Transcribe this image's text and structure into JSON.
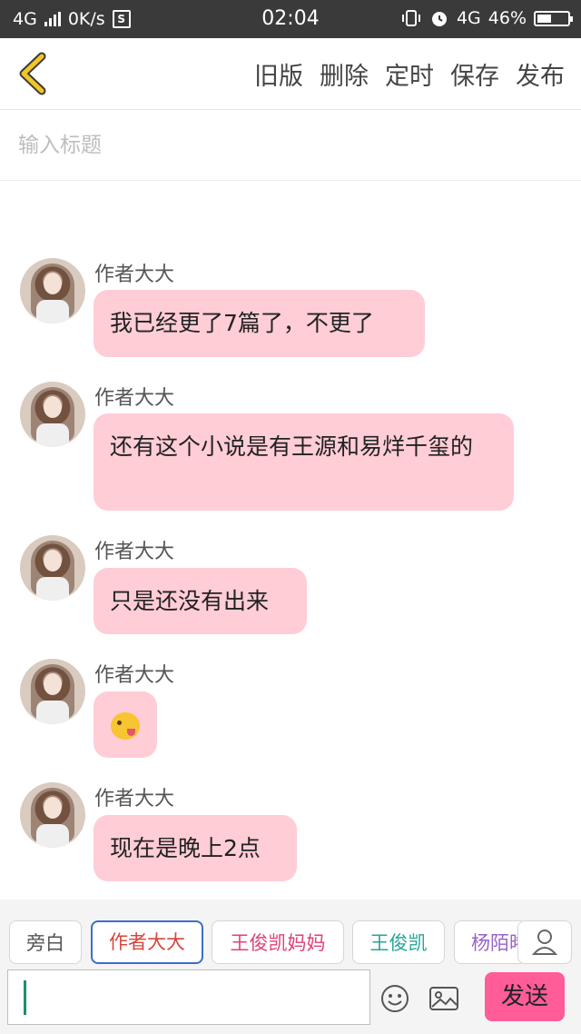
{
  "status_bar": {
    "network_left": "4G",
    "speed": "0K/s",
    "s_badge": "S",
    "time": "02:04",
    "network_right": "4G",
    "battery": "46%",
    "battery_level": 0.46
  },
  "nav": {
    "back_icon": "chevron-left-icon",
    "actions": [
      "旧版",
      "删除",
      "定时",
      "保存",
      "发布"
    ]
  },
  "title_input": {
    "placeholder": "输入标题",
    "value": ""
  },
  "messages": [
    {
      "speaker": "作者大大",
      "text": "我已经更了7篇了，不更了"
    },
    {
      "speaker": "作者大大",
      "text": "还有这个小说是有王源和易烊千玺的"
    },
    {
      "speaker": "作者大大",
      "text": "只是还没有出来"
    },
    {
      "speaker": "作者大大",
      "emoji": "tongue-out-emoji"
    },
    {
      "speaker": "作者大大",
      "text": "现在是晚上2点"
    }
  ],
  "roles": [
    {
      "label": "旁白",
      "color": "#555555"
    },
    {
      "label": "作者大大",
      "color": "#d6453d",
      "selected": true
    },
    {
      "label": "王俊凯妈妈",
      "color": "#e0407a"
    },
    {
      "label": "王俊凯",
      "color": "#27a597"
    },
    {
      "label": "杨陌晞",
      "color": "#9a63c6"
    }
  ],
  "composer": {
    "value": "",
    "emoji_icon": "smiley-icon",
    "image_icon": "image-icon",
    "person_icon": "person-icon",
    "send_label": "发送",
    "send_color": "#ff5c98"
  },
  "colors": {
    "bubble": "#ffcdd6",
    "back_chevron": "#f2c624"
  }
}
